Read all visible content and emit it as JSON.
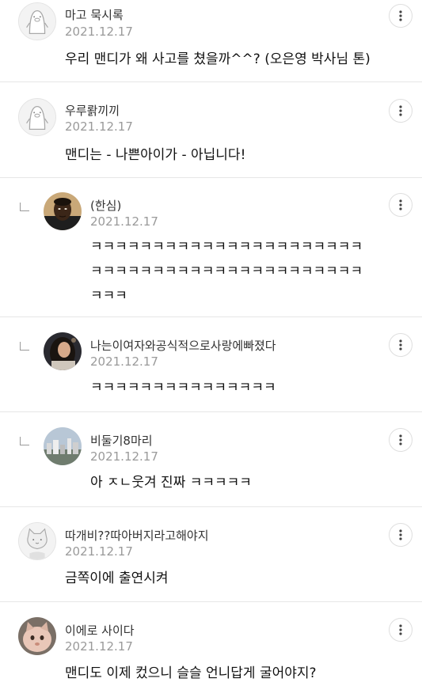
{
  "comments": [
    {
      "author": "마고 묵시록",
      "date": "2021.12.17",
      "text_lines": [
        "우리 맨디가 왜 사고를 쳤을까^^? (오은영 박사님 톤)"
      ],
      "avatar_icon": "penguin-default-avatar",
      "is_reply": false
    },
    {
      "author": "우루뢁끼끼",
      "date": "2021.12.17",
      "text_lines": [
        "맨디는 - 나쁜아이가 - 아닙니다!"
      ],
      "avatar_icon": "penguin-default-avatar",
      "is_reply": false
    },
    {
      "author": "(한심)",
      "date": "2021.12.17",
      "text_lines": [
        "ㅋㅋㅋㅋㅋㅋㅋㅋㅋㅋㅋㅋㅋㅋㅋㅋㅋㅋㅋㅋㅋㅋ",
        "ㅋㅋㅋㅋㅋㅋㅋㅋㅋㅋㅋㅋㅋㅋㅋㅋㅋㅋㅋㅋㅋㅋ",
        "ㅋㅋㅋ"
      ],
      "avatar_icon": "profile-photo-avatar",
      "is_reply": true
    },
    {
      "author": "나는이여자와공식적으로사랑에빠졌다",
      "date": "2021.12.17",
      "text_lines": [
        "ㅋㅋㅋㅋㅋㅋㅋㅋㅋㅋㅋㅋㅋㅋㅋ"
      ],
      "avatar_icon": "profile-photo-avatar",
      "is_reply": true
    },
    {
      "author": "비둘기8마리",
      "date": "2021.12.17",
      "text_lines": [
        "아 ㅈㄴ웃겨 진짜 ㅋㅋㅋㅋㅋ"
      ],
      "avatar_icon": "city-photo-avatar",
      "is_reply": true
    },
    {
      "author": "따개비??따아버지라고해야지",
      "date": "2021.12.17",
      "text_lines": [
        "금쪽이에 출연시켜"
      ],
      "avatar_icon": "cat-mask-avatar",
      "is_reply": false
    },
    {
      "author": "이에로 사이다",
      "date": "2021.12.17",
      "text_lines": [
        "맨디도 이제 컸으니 슬슬 언니답게 굴어야지?"
      ],
      "avatar_icon": "cat-photo-avatar",
      "is_reply": false
    }
  ],
  "more_icon": "more-vertical-icon",
  "colors": {
    "divider": "#e6e6e6",
    "date": "#9a9a9a",
    "author": "#333333",
    "text": "#111111"
  }
}
